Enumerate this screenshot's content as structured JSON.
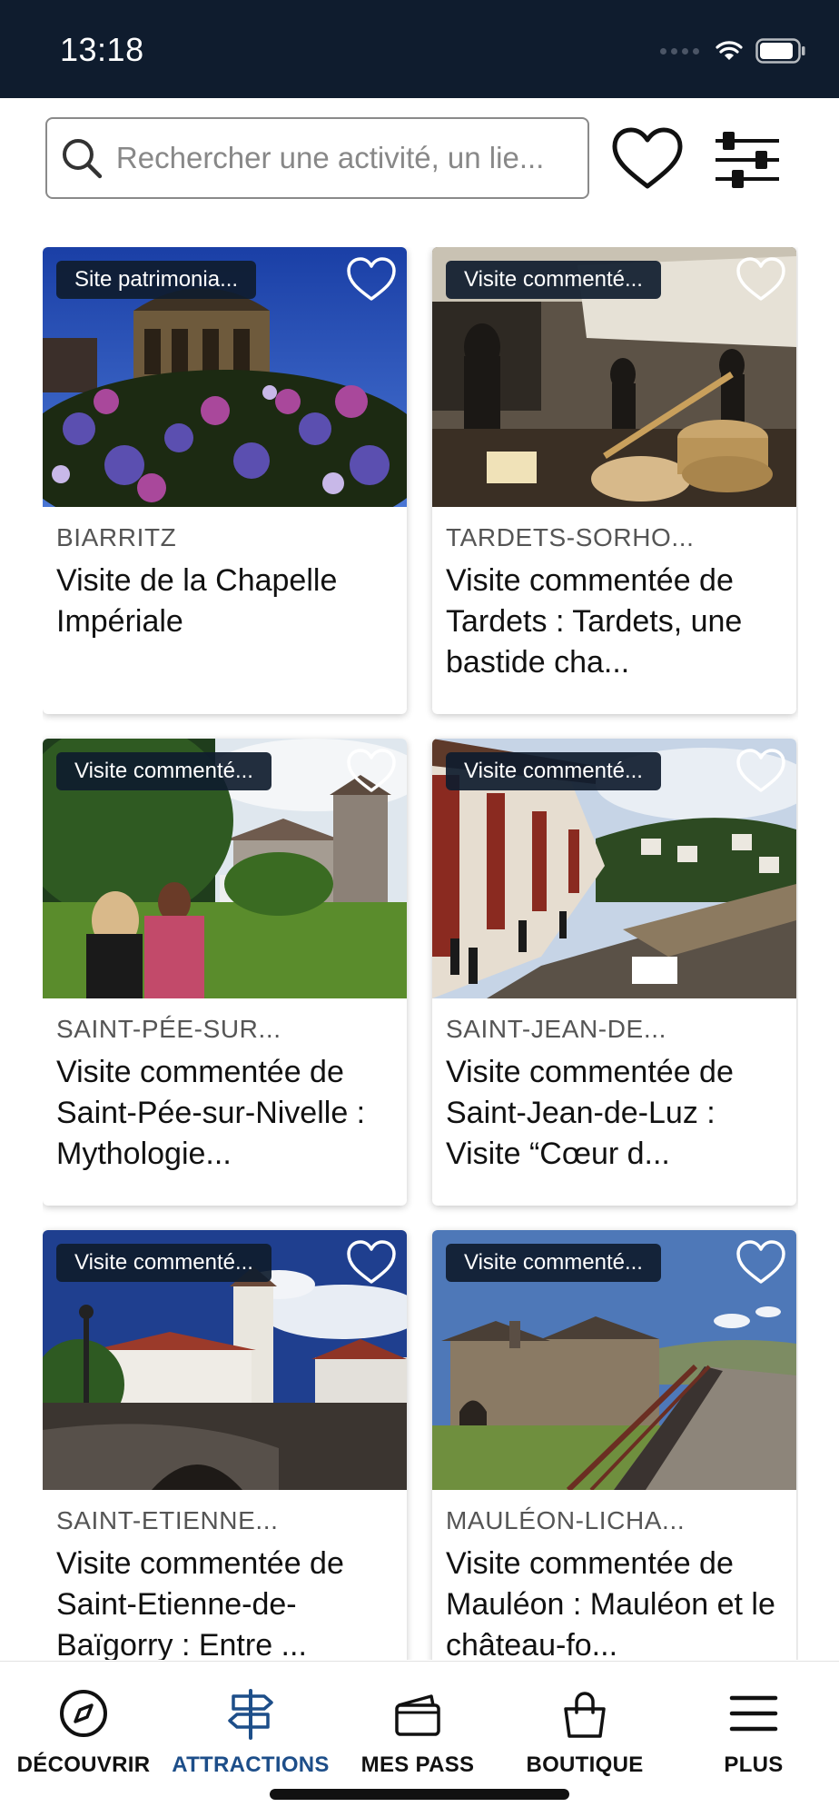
{
  "status": {
    "time": "13:18"
  },
  "search": {
    "placeholder": "Rechercher une activité, un lie..."
  },
  "cards": [
    {
      "badge": "Site patrimonia...",
      "location": "BIARRITZ",
      "title": "Visite de la Chapelle Impériale"
    },
    {
      "badge": "Visite commenté...",
      "location": "TARDETS-SORHO...",
      "title": "Visite commentée de Tardets : Tardets, une bastide cha..."
    },
    {
      "badge": "Visite commenté...",
      "location": "SAINT-PÉE-SUR...",
      "title": "Visite commentée de Saint-Pée-sur-Nivelle : Mythologie..."
    },
    {
      "badge": "Visite commenté...",
      "location": "SAINT-JEAN-DE...",
      "title": "Visite commentée de Saint-Jean-de-Luz : Visite “Cœur d..."
    },
    {
      "badge": "Visite commenté...",
      "location": "SAINT-ETIENNE...",
      "title": "Visite commentée de Saint-Etienne-de-Baïgorry : Entre ..."
    },
    {
      "badge": "Visite commenté...",
      "location": "MAULÉON-LICHA...",
      "title": "Visite commentée de Mauléon : Mauléon et le château-fo..."
    }
  ],
  "nav": [
    {
      "label": "DÉCOUVRIR",
      "icon": "compass-icon",
      "active": false
    },
    {
      "label": "ATTRACTIONS",
      "icon": "signpost-icon",
      "active": true
    },
    {
      "label": "MES PASS",
      "icon": "wallet-icon",
      "active": false
    },
    {
      "label": "BOUTIQUE",
      "icon": "shopping-bag-icon",
      "active": false
    },
    {
      "label": "PLUS",
      "icon": "menu-icon",
      "active": false
    }
  ],
  "colors": {
    "status_bar": "#0f1c2e",
    "active_nav": "#1d4e89",
    "badge_bg": "#0f1c2e"
  }
}
